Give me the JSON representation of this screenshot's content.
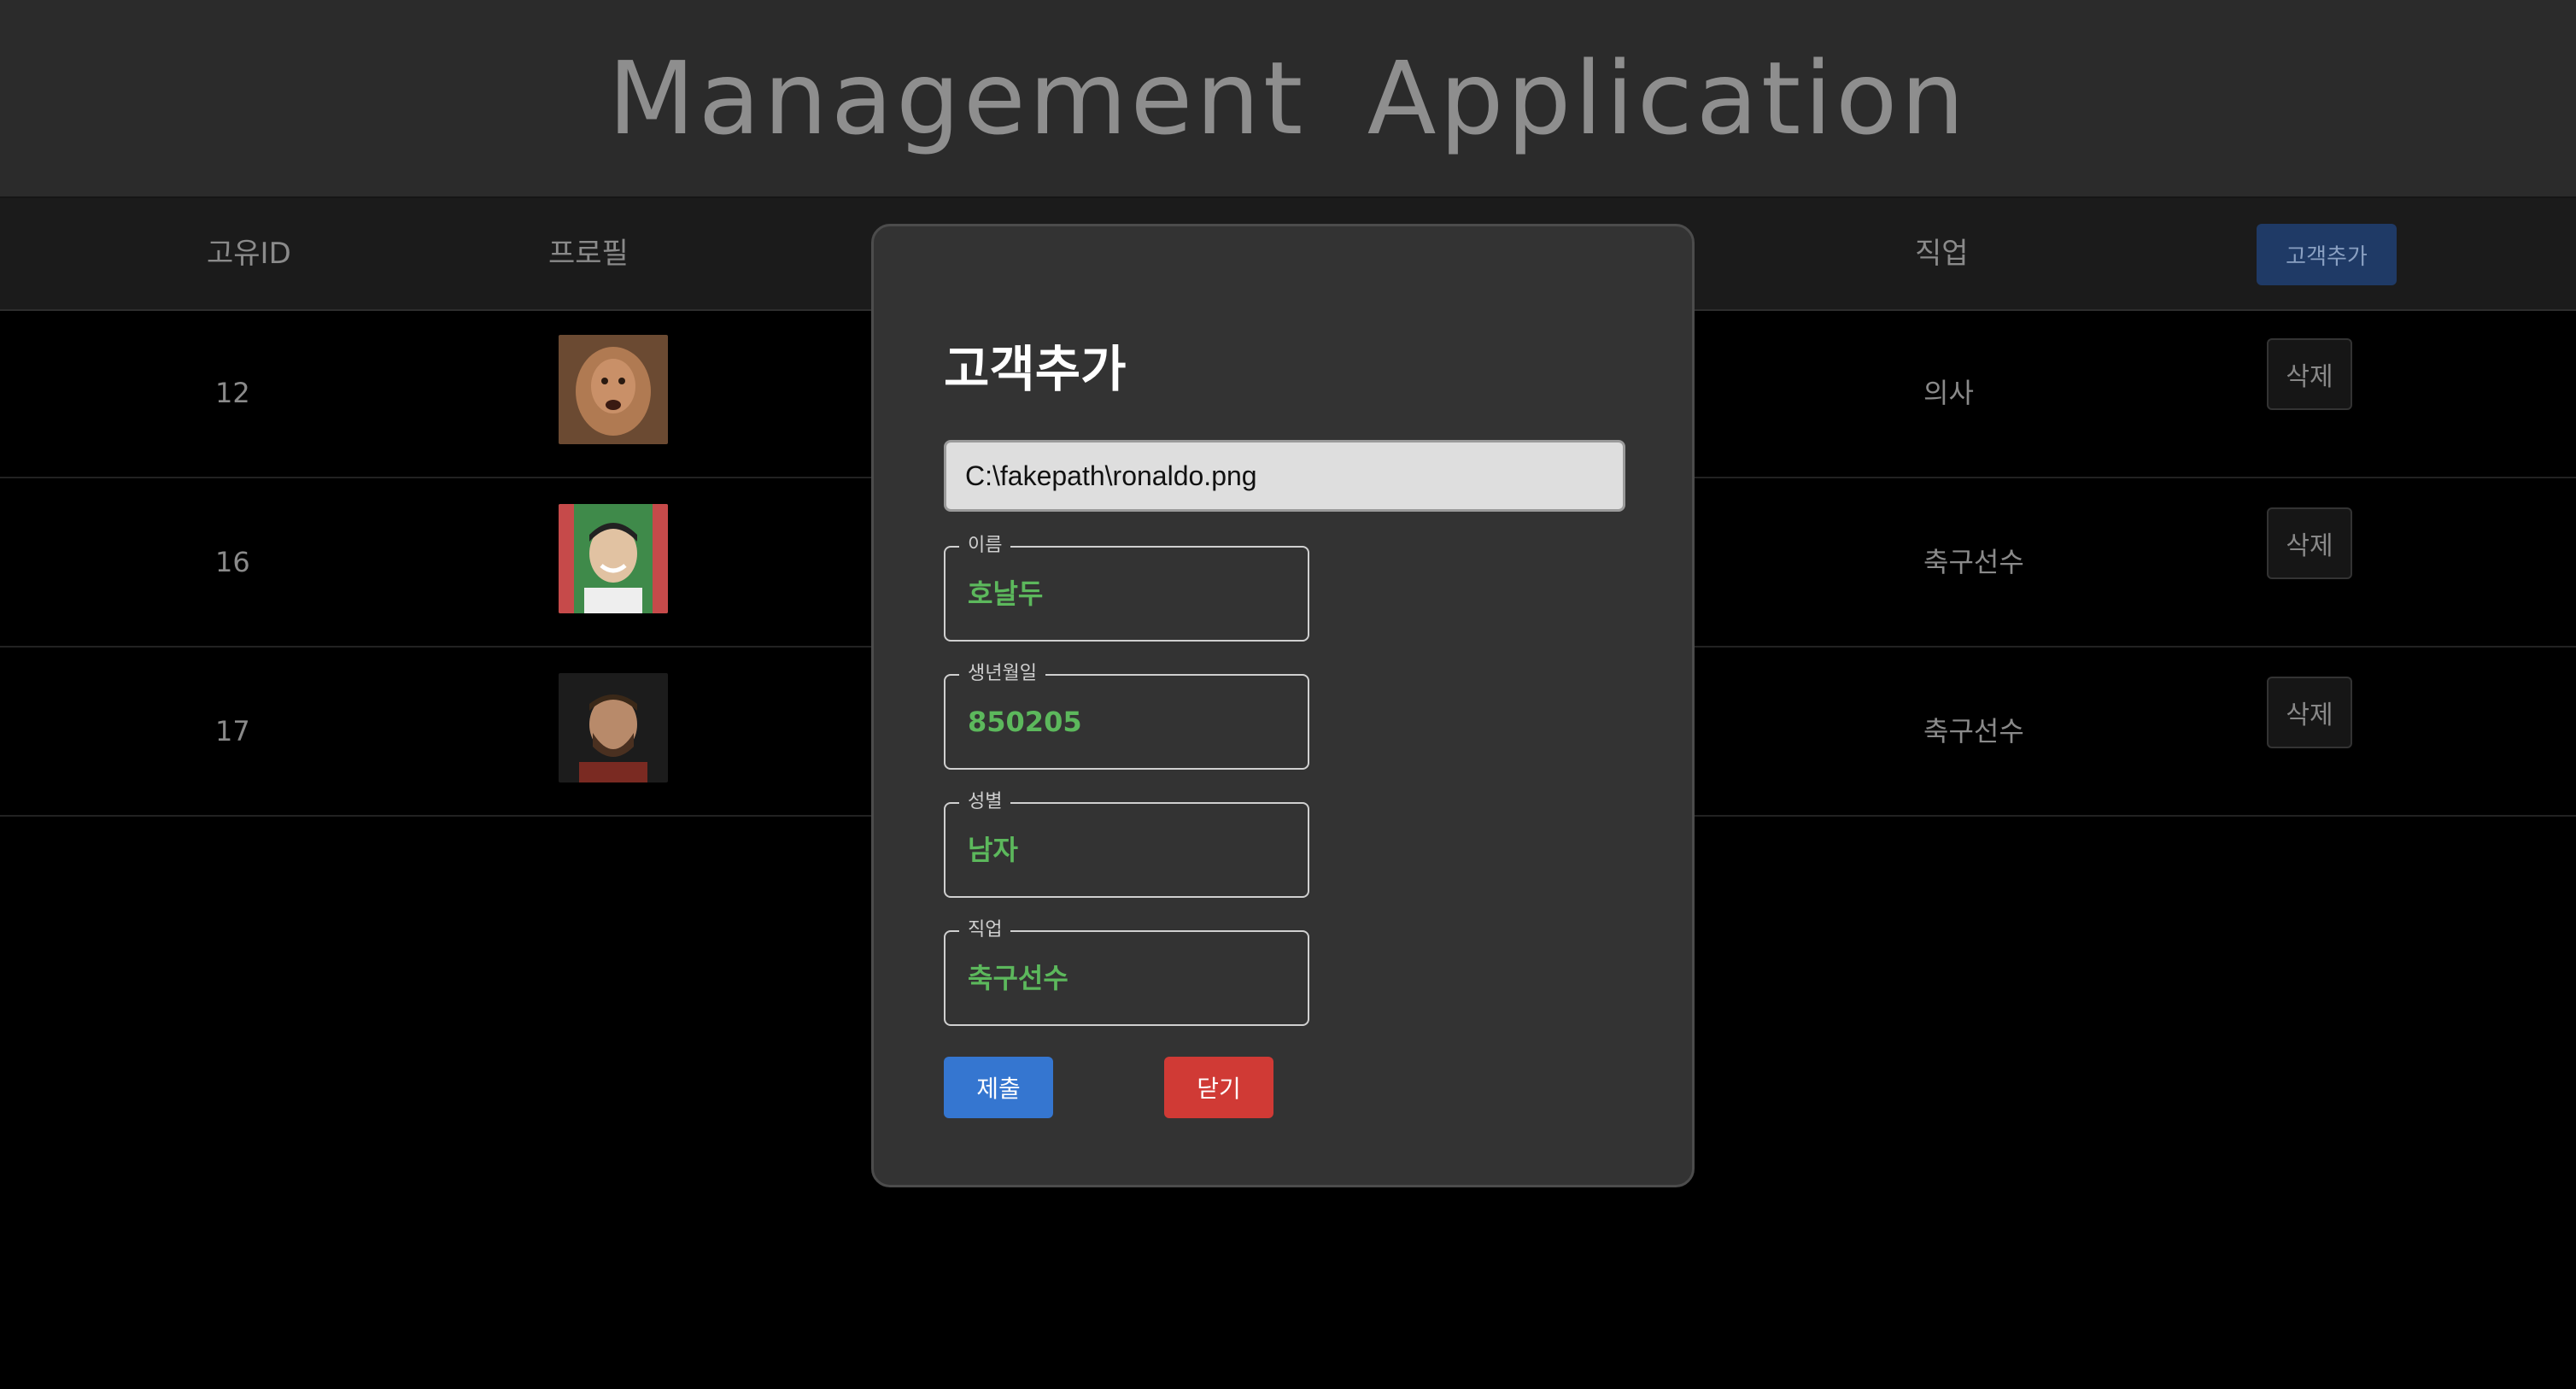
{
  "app": {
    "title": "Management  Application"
  },
  "table": {
    "headers": {
      "id": "고유ID",
      "profile": "프로필",
      "job": "직업"
    },
    "add_button_label": "고객추가",
    "rows": [
      {
        "id": "12",
        "job": "의사",
        "delete_label": "삭제",
        "avatar": "profile-photo"
      },
      {
        "id": "16",
        "job": "축구선수",
        "delete_label": "삭제",
        "avatar": "profile-photo"
      },
      {
        "id": "17",
        "job": "축구선수",
        "delete_label": "삭제",
        "avatar": "profile-photo"
      }
    ]
  },
  "modal": {
    "title": "고객추가",
    "file_value": "C:\\fakepath\\ronaldo.png",
    "fields": [
      {
        "label": "이름",
        "value": "호날두"
      },
      {
        "label": "생년월일",
        "value": "850205"
      },
      {
        "label": "성별",
        "value": "남자"
      },
      {
        "label": "직업",
        "value": "축구선수"
      }
    ],
    "submit_label": "제출",
    "close_label": "닫기"
  },
  "colors": {
    "primary": "#3576d0",
    "danger": "#d03a35",
    "field_text": "#5cb85c"
  }
}
